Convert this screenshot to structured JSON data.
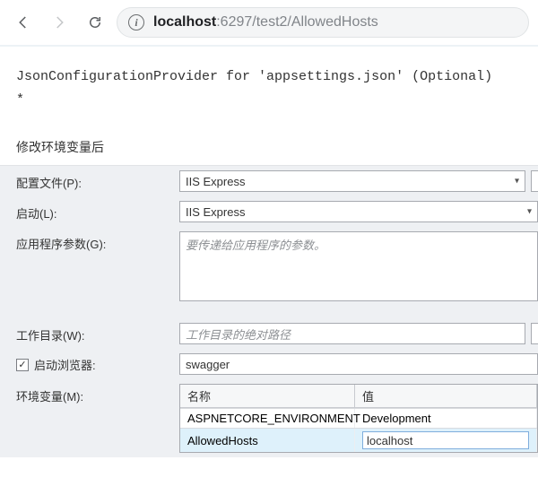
{
  "browser": {
    "url_host": "localhost",
    "url_rest": ":6297/test2/AllowedHosts"
  },
  "page_output": {
    "line1": "JsonConfigurationProvider for 'appsettings.json' (Optional)",
    "line2": "*"
  },
  "section_caption": "修改环境变量后",
  "form": {
    "profile": {
      "label": "配置文件(P):",
      "value": "IIS Express"
    },
    "launch": {
      "label": "启动(L):",
      "value": "IIS Express"
    },
    "args": {
      "label": "应用程序参数(G):",
      "placeholder": "要传递给应用程序的参数。"
    },
    "workdir": {
      "label": "工作目录(W):",
      "placeholder": "工作目录的绝对路径"
    },
    "launch_browser": {
      "label": "启动浏览器:",
      "value": "swagger",
      "checked": true,
      "check_glyph": "✓"
    },
    "envvars": {
      "label": "环境变量(M):",
      "columns": {
        "name": "名称",
        "value": "值"
      },
      "rows": [
        {
          "name": "ASPNETCORE_ENVIRONMENT",
          "value": "Development"
        },
        {
          "name": "AllowedHosts",
          "value": "localhost"
        }
      ]
    }
  }
}
